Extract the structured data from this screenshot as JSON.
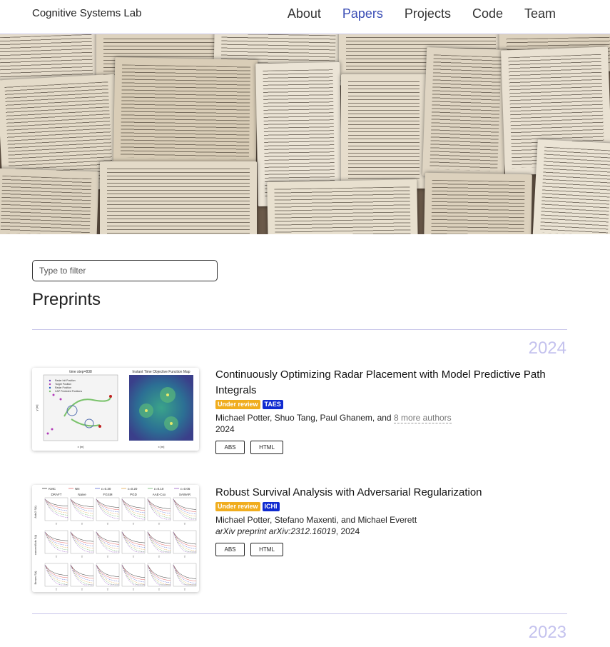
{
  "nav": {
    "brand": "Cognitive Systems Lab",
    "links": [
      {
        "label": "About",
        "active": false
      },
      {
        "label": "Papers",
        "active": true
      },
      {
        "label": "Projects",
        "active": false
      },
      {
        "label": "Code",
        "active": false
      },
      {
        "label": "Team",
        "active": false
      }
    ]
  },
  "filter": {
    "placeholder": "Type to filter"
  },
  "section": {
    "title": "Preprints"
  },
  "years": [
    "2024",
    "2023"
  ],
  "papers": [
    {
      "title": "Continuously Optimizing Radar Placement with Model Predictive Path Integrals",
      "status_badge": "Under review",
      "venue_badge": "TAES",
      "authors": "Michael Potter, Shuo Tang, Paul Ghanem, and",
      "more_authors": "8 more authors",
      "venue_italic": "",
      "year": "2024",
      "buttons": [
        "ABS",
        "HTML"
      ],
      "thumb_left_title": "time step=838",
      "thumb_right_title": "Instant Time Objective Function Map",
      "thumb_legend": [
        "Radar Init Position",
        "Target Position",
        "Radar Position",
        "CAP Predicted Positions"
      ],
      "thumb_xlabel": "x [m]",
      "thumb_ylabel": "y [m]"
    },
    {
      "title": "Robust Survival Analysis with Adversarial Regularization",
      "status_badge": "Under review",
      "venue_badge": "ICHI",
      "authors": "Michael Potter, Stefano Maxenti, and Michael Everett",
      "more_authors": "",
      "venue_italic": "arXiv preprint arXiv:2312.16019",
      "year": "2024",
      "buttons": [
        "ABS",
        "HTML"
      ],
      "thumb_legend": [
        "KMC",
        "NN",
        "ε=0.30",
        "ε=0.20",
        "ε=0.10",
        "ε=0.05"
      ],
      "thumb_columns": [
        "DRAFT",
        "Naive",
        "FGSM",
        "PGD",
        "AAE-Cox",
        "SAWAR"
      ],
      "thumb_rows": [
        "Aids2 S(t)",
        "cancer/Aids S(t)",
        "Brown S(t)"
      ],
      "thumb_xtick": "T"
    }
  ],
  "colors": {
    "accent": "#3a4db5",
    "year": "#c4c2ee",
    "divider": "#c9c6ea",
    "badge_review": "#f0ad1e",
    "badge_venue": "#0f2ad0"
  }
}
